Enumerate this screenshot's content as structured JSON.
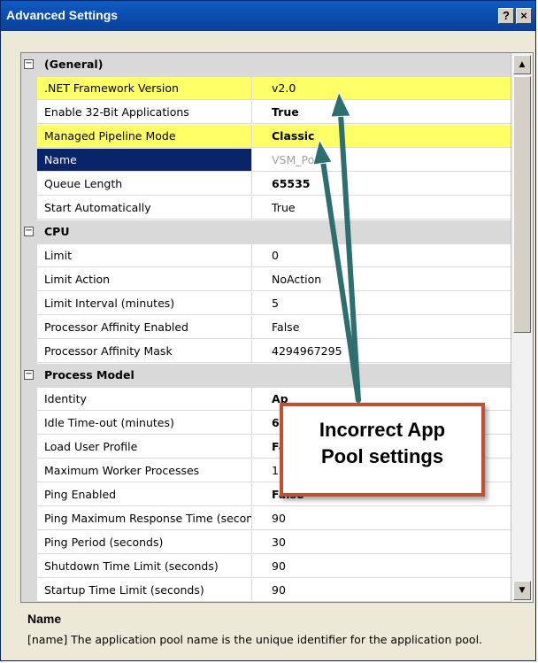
{
  "window": {
    "title": "Advanced Settings",
    "help_label": "?",
    "close_label": "×"
  },
  "categories": {
    "general": "(General)",
    "cpu": "CPU",
    "process_model": "Process Model"
  },
  "toggle_glyph": "⊟",
  "rows": [
    {
      "name": ".NET Framework Version",
      "value": "v2.0"
    },
    {
      "name": "Enable 32-Bit Applications",
      "value": "True"
    },
    {
      "name": "Managed Pipeline Mode",
      "value": "Classic"
    },
    {
      "name": "Name",
      "value": "VSM_Po..."
    },
    {
      "name": "Queue Length",
      "value": "65535"
    },
    {
      "name": "Start Automatically",
      "value": "True"
    },
    {
      "name": "Limit",
      "value": "0"
    },
    {
      "name": "Limit Action",
      "value": "NoAction"
    },
    {
      "name": "Limit Interval (minutes)",
      "value": "5"
    },
    {
      "name": "Processor Affinity Enabled",
      "value": "False"
    },
    {
      "name": "Processor Affinity Mask",
      "value": "4294967295"
    },
    {
      "name": "Identity",
      "value": "Ap"
    },
    {
      "name": "Idle Time-out (minutes)",
      "value": "60"
    },
    {
      "name": "Load User Profile",
      "value": "Fa"
    },
    {
      "name": "Maximum Worker Processes",
      "value": "1"
    },
    {
      "name": "Ping Enabled",
      "value": "False"
    },
    {
      "name": "Ping Maximum Response Time (seconds)",
      "value": "90"
    },
    {
      "name": "Ping Period (seconds)",
      "value": "30"
    },
    {
      "name": "Shutdown Time Limit (seconds)",
      "value": "90"
    },
    {
      "name": "Startup Time Limit (seconds)",
      "value": "90"
    }
  ],
  "scrollbar": {
    "up": "▲",
    "down": "▼"
  },
  "description": {
    "title": "Name",
    "text": "[name] The application pool name is the unique identifier for the application pool."
  },
  "callout": {
    "line1": "Incorrect App",
    "line2": "Pool settings"
  },
  "colors": {
    "highlight": "#ffff66",
    "selection": "#0a246a",
    "arrow": "#2d6e6e",
    "callout_border": "#c05030"
  }
}
